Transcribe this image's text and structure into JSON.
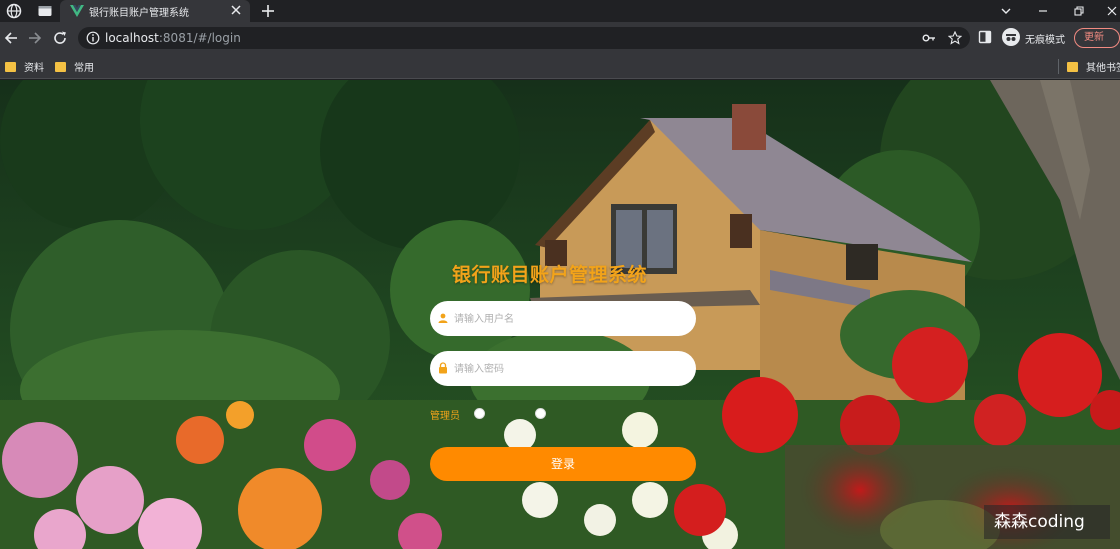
{
  "browser": {
    "tab_title": "银行账目账户管理系统",
    "url_host": "localhost",
    "url_rest": ":8081/#/login",
    "profile_label": "无痕模式",
    "update_label": "更新",
    "bookmarks": [
      "资料",
      "常用"
    ],
    "other_bookmarks": "其他书签"
  },
  "login": {
    "title": "银行账目账户管理系统",
    "username_placeholder": "请输入用户名",
    "password_placeholder": "请输入密码",
    "role_label": "管理员",
    "submit_label": "登录"
  },
  "watermark": "森森coding",
  "colors": {
    "accent": "#ff8a00",
    "title": "#f2a31a"
  }
}
